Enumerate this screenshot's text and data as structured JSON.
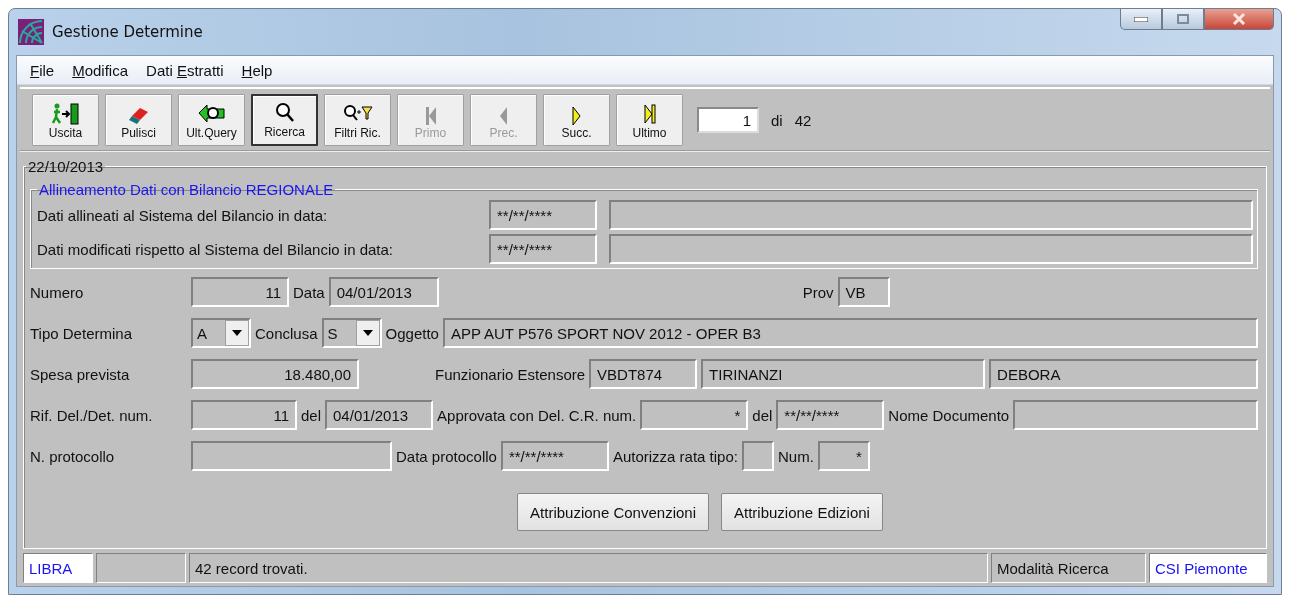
{
  "window": {
    "title": "Gestione Determine"
  },
  "menu": [
    {
      "accel": "F",
      "rest": "ile"
    },
    {
      "accel": "M",
      "rest": "odifica"
    },
    {
      "before": "Dati ",
      "accel": "E",
      "rest": "stratti"
    },
    {
      "accel": "H",
      "rest": "elp"
    }
  ],
  "toolbar": {
    "buttons": [
      {
        "label": "Uscita",
        "disabled": false,
        "selected": false
      },
      {
        "label": "Pulisci",
        "disabled": false,
        "selected": false
      },
      {
        "label": "Ult.Query",
        "disabled": false,
        "selected": false
      },
      {
        "label": "Ricerca",
        "disabled": false,
        "selected": true
      },
      {
        "label": "Filtri Ric.",
        "disabled": false,
        "selected": false
      },
      {
        "label": "Primo",
        "disabled": true,
        "selected": false
      },
      {
        "label": "Prec.",
        "disabled": true,
        "selected": false
      },
      {
        "label": "Succ.",
        "disabled": false,
        "selected": false
      },
      {
        "label": "Ultimo",
        "disabled": false,
        "selected": false
      }
    ],
    "record": {
      "value": "1",
      "of_label": "di",
      "total": "42"
    }
  },
  "form": {
    "title": "22/10/2013",
    "alignment": {
      "title": "Allineamento Dati con Bilancio REGIONALE",
      "rows": [
        {
          "label": "Dati allineati al Sistema del Bilancio in data:",
          "date": "**/**/****"
        },
        {
          "label": "Dati modificati rispetto al Sistema del Bilancio in data:",
          "date": "**/**/****"
        }
      ]
    },
    "rows": [
      {
        "items": [
          {
            "kind": "label",
            "text": "Numero"
          },
          {
            "kind": "field",
            "value": "11"
          },
          {
            "kind": "label",
            "text": "Data"
          },
          {
            "kind": "field",
            "value": "04/01/2013"
          },
          {
            "kind": "label",
            "text": "Prov"
          },
          {
            "kind": "field",
            "value": "VB"
          }
        ]
      },
      {
        "items": [
          {
            "kind": "label",
            "text": "Tipo Determina"
          },
          {
            "kind": "combo",
            "value": "A"
          },
          {
            "kind": "label",
            "text": "Conclusa"
          },
          {
            "kind": "combo",
            "value": "S"
          },
          {
            "kind": "label",
            "text": "Oggetto"
          },
          {
            "kind": "field",
            "value": "APP AUT P576 SPORT NOV 2012 - OPER B3"
          }
        ]
      },
      {
        "items": [
          {
            "kind": "label",
            "text": "Spesa prevista"
          },
          {
            "kind": "field",
            "value": "18.480,00"
          },
          {
            "kind": "label",
            "text": "Funzionario Estensore"
          },
          {
            "kind": "field",
            "value": "VBDT874"
          },
          {
            "kind": "field",
            "value": "TIRINANZI"
          },
          {
            "kind": "field",
            "value": "DEBORA"
          }
        ]
      },
      {
        "items": [
          {
            "kind": "label",
            "text": "Rif. Del./Det. num."
          },
          {
            "kind": "field",
            "value": "11"
          },
          {
            "kind": "label",
            "text": "del"
          },
          {
            "kind": "field",
            "value": "04/01/2013"
          },
          {
            "kind": "label",
            "text": "Approvata con Del. C.R. num."
          },
          {
            "kind": "field",
            "value": "*"
          },
          {
            "kind": "label",
            "text": "del"
          },
          {
            "kind": "field",
            "value": "**/**/****"
          },
          {
            "kind": "label",
            "text": "Nome Documento"
          },
          {
            "kind": "field"
          }
        ]
      },
      {
        "items": [
          {
            "kind": "label",
            "text": "N. protocollo"
          },
          {
            "kind": "field"
          },
          {
            "kind": "label",
            "text": "Data protocollo"
          },
          {
            "kind": "field",
            "value": "**/**/****"
          },
          {
            "kind": "label",
            "text": "Autorizza rata tipo:"
          },
          {
            "kind": "field"
          },
          {
            "kind": "label",
            "text": "Num."
          },
          {
            "kind": "field",
            "value": "*"
          }
        ]
      }
    ],
    "buttons": [
      "Attribuzione Convenzioni",
      "Attribuzione Edizioni"
    ]
  },
  "status_bar": [
    {
      "text": "LIBRA",
      "kind": "app"
    },
    {
      "kind": "plain"
    },
    {
      "text": "42 record trovati.",
      "kind": "plain"
    },
    {
      "text": "Modalità Ricerca",
      "kind": "plain"
    },
    {
      "text": "CSI Piemonte",
      "kind": "app"
    }
  ]
}
